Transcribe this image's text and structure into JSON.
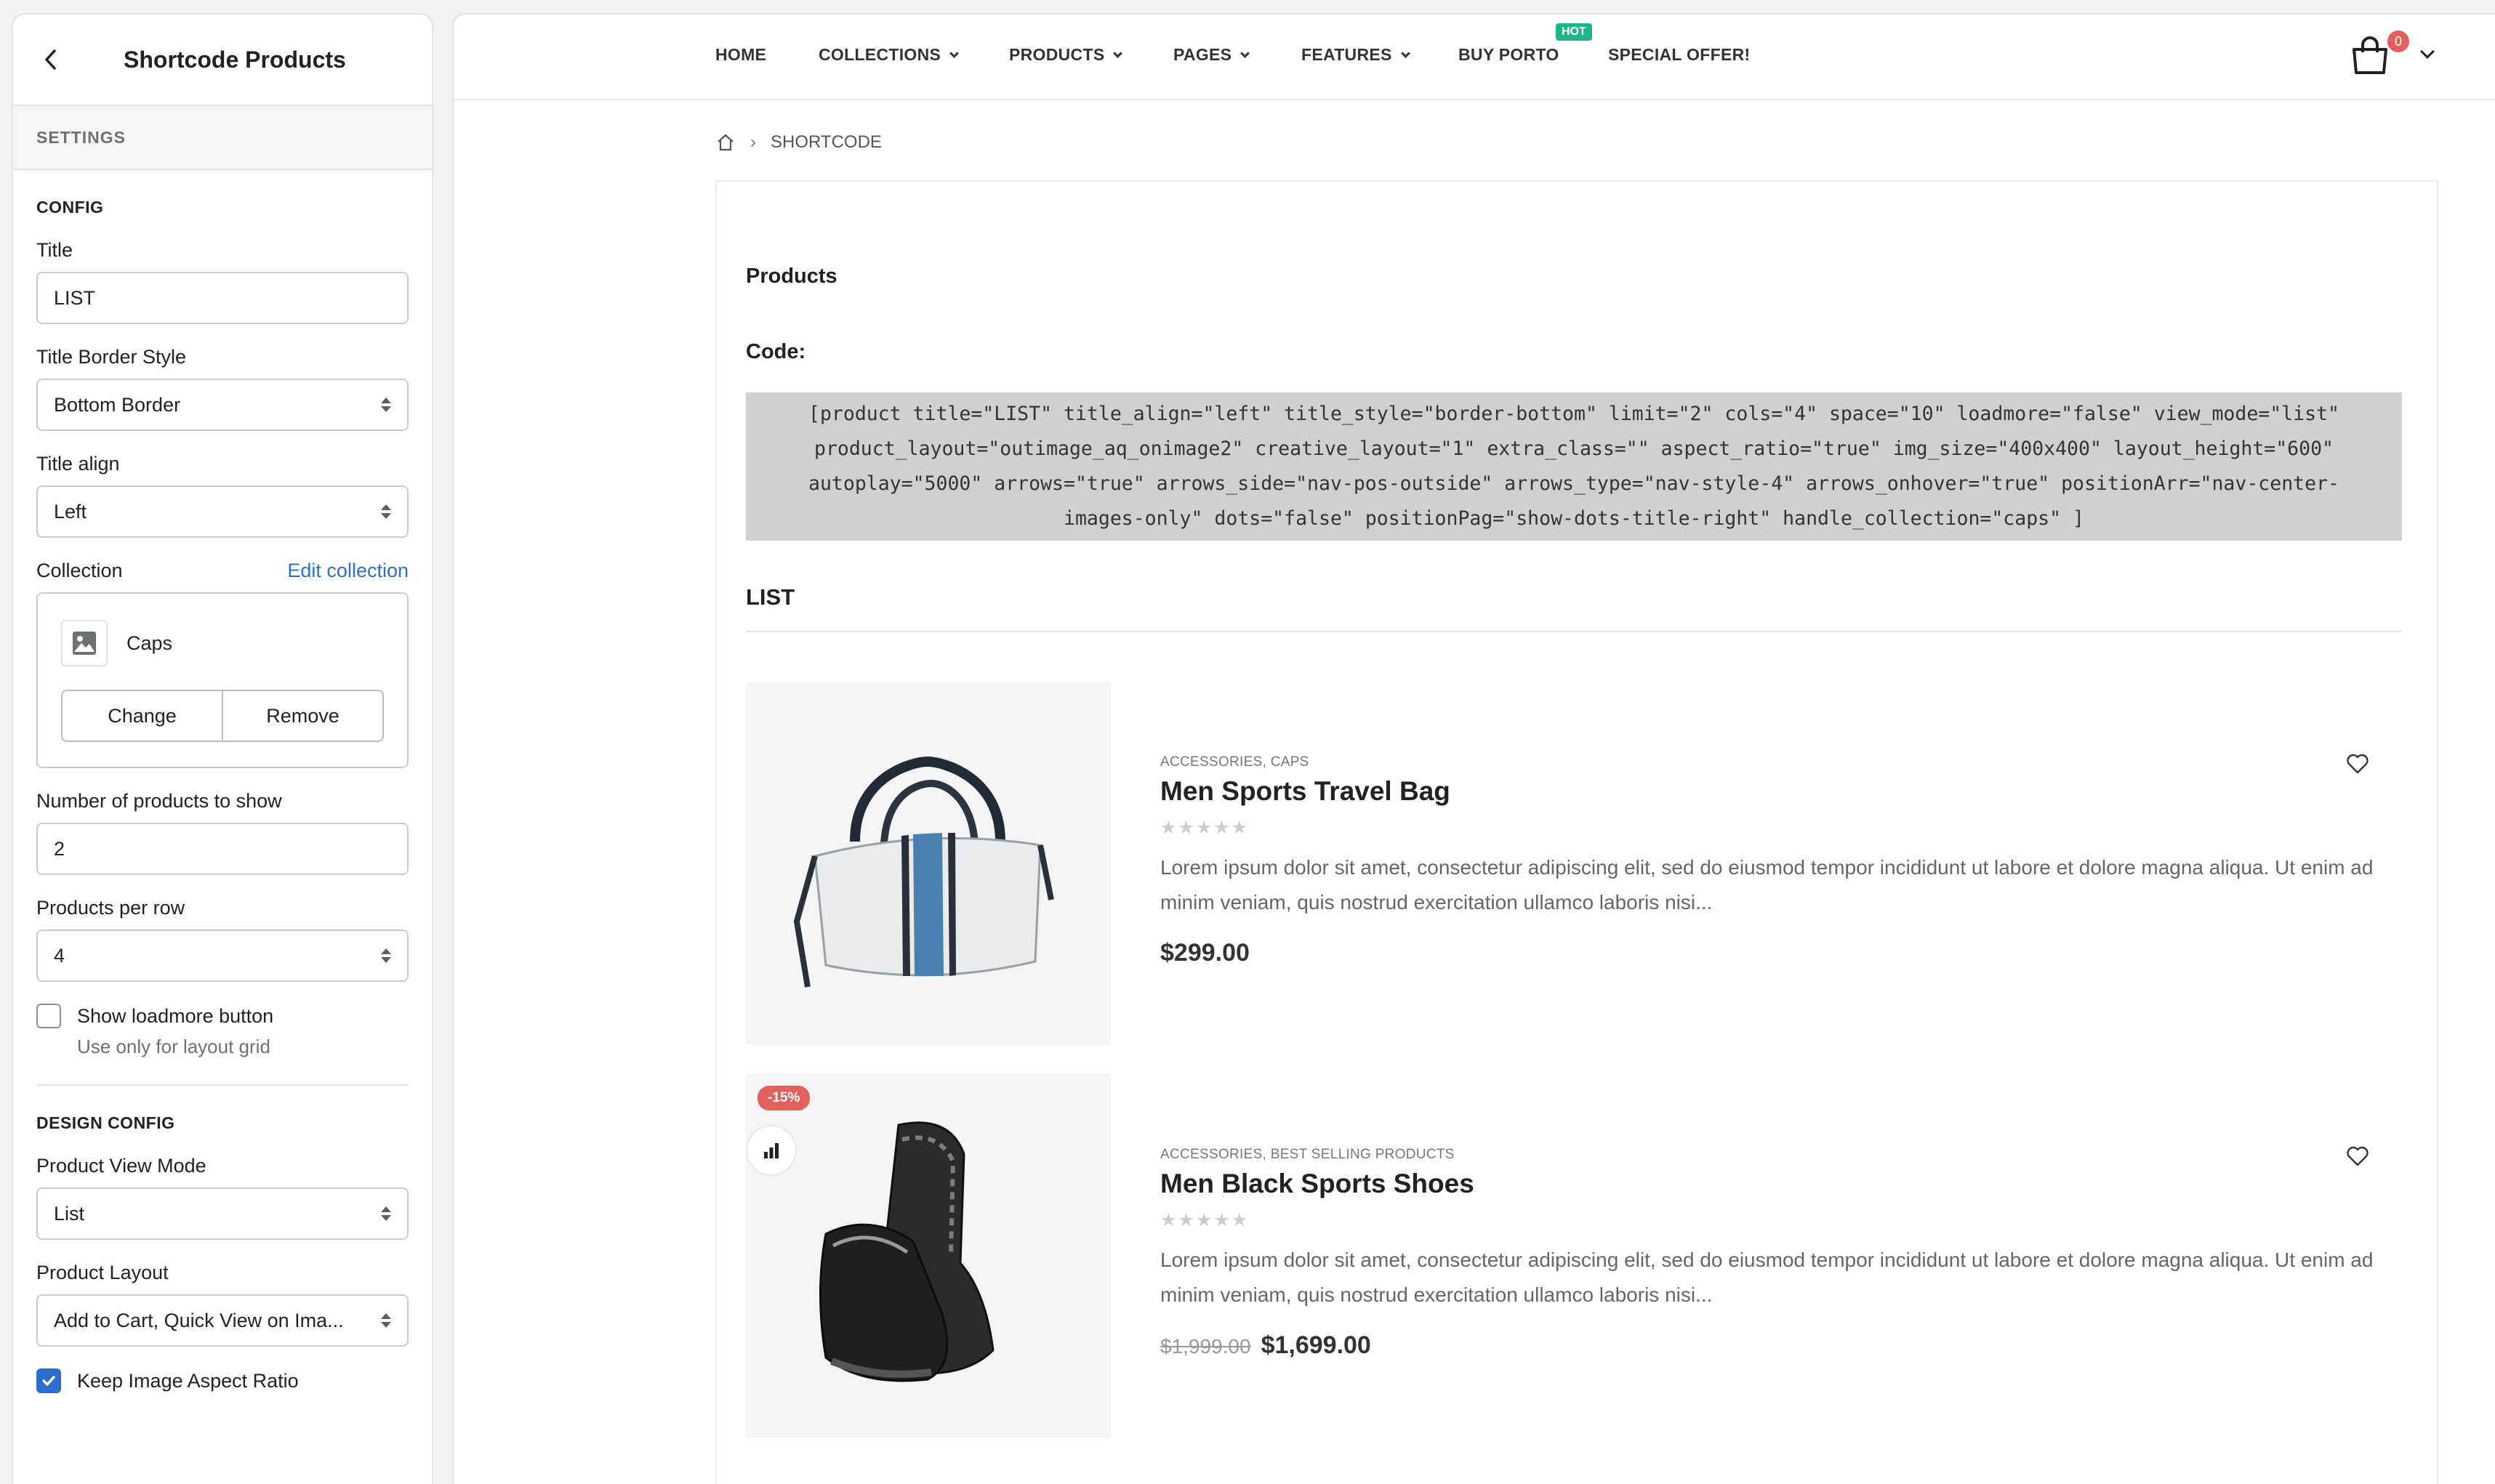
{
  "panel": {
    "title": "Shortcode Products",
    "section": "SETTINGS",
    "config_heading": "CONFIG",
    "title_label": "Title",
    "title_value": "LIST",
    "border_label": "Title Border Style",
    "border_value": "Bottom Border",
    "align_label": "Title align",
    "align_value": "Left",
    "collection_label": "Collection",
    "edit_collection": "Edit collection",
    "collection_name": "Caps",
    "change_button": "Change",
    "remove_button": "Remove",
    "count_label": "Number of products to show",
    "count_value": "2",
    "per_row_label": "Products per row",
    "per_row_value": "4",
    "loadmore_label": "Show loadmore button",
    "loadmore_checked": false,
    "loadmore_help": "Use only for layout grid",
    "design_heading": "DESIGN CONFIG",
    "view_mode_label": "Product View Mode",
    "view_mode_value": "List",
    "layout_label": "Product Layout",
    "layout_value": "Add to Cart, Quick View on Ima...",
    "aspect_label": "Keep Image Aspect Ratio",
    "aspect_checked": true
  },
  "nav": {
    "items": [
      "HOME",
      "COLLECTIONS",
      "PRODUCTS",
      "PAGES",
      "FEATURES",
      "BUY PORTO",
      "SPECIAL OFFER!"
    ],
    "hot_badge": "HOT",
    "cart_count": "0"
  },
  "breadcrumb": {
    "current": "SHORTCODE"
  },
  "content": {
    "products_heading": "Products",
    "code_heading": "Code:",
    "code_lines": [
      "[product title=\"LIST\" title_align=\"left\" title_style=\"border-bottom\" limit=\"2\" cols=\"4\" space=\"10\" loadmore=\"false\" view_mode=\"list\"",
      "product_layout=\"outimage_aq_onimage2\" creative_layout=\"1\" extra_class=\"\" aspect_ratio=\"true\" img_size=\"400x400\" layout_height=\"600\"",
      "autoplay=\"5000\" arrows=\"true\" arrows_side=\"nav-pos-outside\" arrows_type=\"nav-style-4\" arrows_onhover=\"true\" positionArr=\"nav-center-",
      "images-only\" dots=\"false\" positionPag=\"show-dots-title-right\" handle_collection=\"caps\" ]"
    ],
    "list_heading": "LIST"
  },
  "products": [
    {
      "categories": "ACCESSORIES, CAPS",
      "name": "Men Sports Travel Bag",
      "stars": "★★★★★",
      "description": "Lorem ipsum dolor sit amet, consectetur adipiscing elit, sed do eiusmod tempor incididunt ut labore et dolore magna aliqua. Ut enim ad minim veniam, quis nostrud exercitation ullamco laboris nisi...",
      "price": "$299.00",
      "old_price": ""
    },
    {
      "categories": "ACCESSORIES, BEST SELLING PRODUCTS",
      "name": "Men Black Sports Shoes",
      "stars": "★★★★★",
      "description": "Lorem ipsum dolor sit amet, consectetur adipiscing elit, sed do eiusmod tempor incididunt ut labore et dolore magna aliqua. Ut enim ad minim veniam, quis nostrud exercitation ullamco laboris nisi...",
      "price": "$1,699.00",
      "old_price": "$1,999.00",
      "sale_badge": "-15%"
    }
  ]
}
